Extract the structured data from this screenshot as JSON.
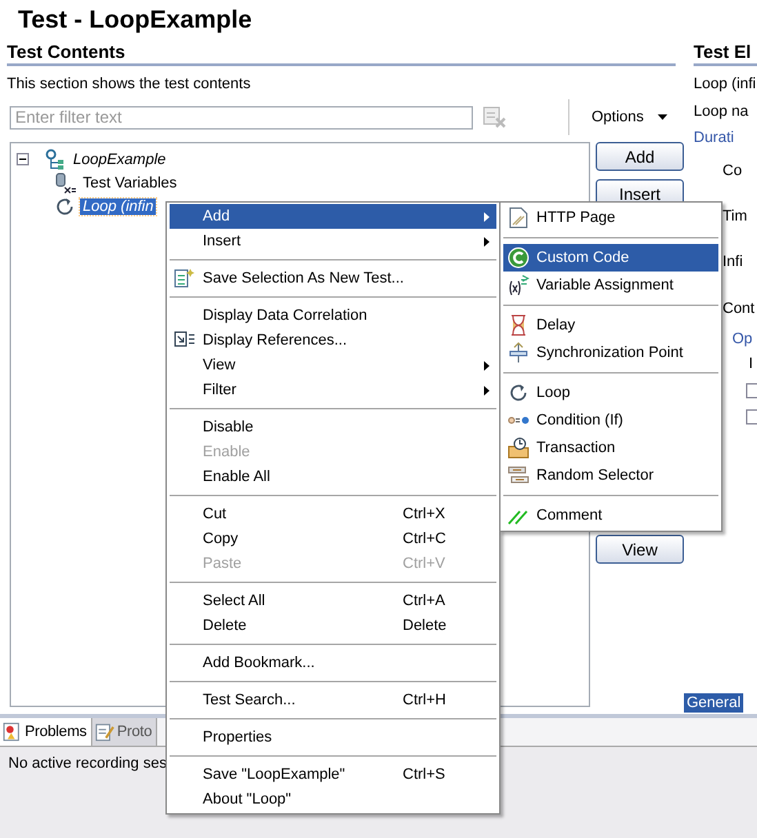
{
  "editor": {
    "title": "Test - LoopExample"
  },
  "contents": {
    "heading": "Test Contents",
    "description": "This section shows the test contents",
    "filter": {
      "placeholder": "Enter filter text"
    },
    "options": "Options",
    "tree": [
      {
        "label": "LoopExample",
        "kind": "test",
        "italic": true,
        "expanded": true,
        "selected": false,
        "children": [
          {
            "label": "Test Variables",
            "kind": "variables",
            "italic": false,
            "selected": false
          },
          {
            "label": "Loop (infin",
            "kind": "loop",
            "italic": true,
            "selected": true
          }
        ]
      }
    ],
    "buttons": [
      "Add",
      "Insert",
      "View"
    ]
  },
  "details": {
    "heading": "Test El",
    "summary": "Loop (infi",
    "name_label": "Loop na",
    "duration_group": "Durati",
    "radios": [
      "Co",
      "Tim",
      "Infi"
    ],
    "control_label": "Cont",
    "options_group": "Op",
    "option_label": "I",
    "checkboxes": [
      {
        "checked": false
      },
      {
        "checked": false
      }
    ],
    "tab": "General"
  },
  "bottom": {
    "tabs": [
      {
        "label": "Problems",
        "kind": "problems",
        "selected": true
      },
      {
        "label": "Proto",
        "kind": "protocol",
        "selected": false
      }
    ],
    "status": "No active recording ses"
  },
  "context_menu": {
    "groups": [
      [
        {
          "label": "Add",
          "submenu": true,
          "disabled": false,
          "selected": true
        },
        {
          "label": "Insert",
          "submenu": true,
          "disabled": false,
          "selected": false
        }
      ],
      [
        {
          "label": "Save Selection As New Test...",
          "kind": "save-selection",
          "submenu": false,
          "disabled": false,
          "selected": false
        }
      ],
      [
        {
          "label": "Display Data Correlation",
          "submenu": false,
          "disabled": false,
          "selected": false
        },
        {
          "label": "Display References...",
          "kind": "references",
          "submenu": false,
          "disabled": false,
          "selected": false
        },
        {
          "label": "View",
          "submenu": true,
          "disabled": false,
          "selected": false
        },
        {
          "label": "Filter",
          "submenu": true,
          "disabled": false,
          "selected": false
        }
      ],
      [
        {
          "label": "Disable",
          "submenu": false,
          "disabled": false,
          "selected": false
        },
        {
          "label": "Enable",
          "submenu": false,
          "disabled": true,
          "selected": false
        },
        {
          "label": "Enable All",
          "submenu": false,
          "disabled": false,
          "selected": false
        }
      ],
      [
        {
          "label": "Cut",
          "shortcut": "Ctrl+X",
          "submenu": false,
          "disabled": false,
          "selected": false
        },
        {
          "label": "Copy",
          "shortcut": "Ctrl+C",
          "submenu": false,
          "disabled": false,
          "selected": false
        },
        {
          "label": "Paste",
          "shortcut": "Ctrl+V",
          "submenu": false,
          "disabled": true,
          "selected": false
        }
      ],
      [
        {
          "label": "Select All",
          "shortcut": "Ctrl+A",
          "submenu": false,
          "disabled": false,
          "selected": false
        },
        {
          "label": "Delete",
          "shortcut": "Delete",
          "submenu": false,
          "disabled": false,
          "selected": false
        }
      ],
      [
        {
          "label": "Add Bookmark...",
          "submenu": false,
          "disabled": false,
          "selected": false
        }
      ],
      [
        {
          "label": "Test Search...",
          "shortcut": "Ctrl+H",
          "submenu": false,
          "disabled": false,
          "selected": false
        }
      ],
      [
        {
          "label": "Properties",
          "submenu": false,
          "disabled": false,
          "selected": false
        }
      ],
      [
        {
          "label": "Save \"LoopExample\"",
          "shortcut": "Ctrl+S",
          "submenu": false,
          "disabled": false,
          "selected": false
        },
        {
          "label": "About \"Loop\"",
          "submenu": false,
          "disabled": false,
          "selected": false
        }
      ]
    ]
  },
  "submenu": {
    "groups": [
      [
        {
          "label": "HTTP Page",
          "kind": "http",
          "selected": false
        }
      ],
      [
        {
          "label": "Custom Code",
          "kind": "custom-code",
          "selected": true
        },
        {
          "label": "Variable Assignment",
          "kind": "variable",
          "selected": false
        }
      ],
      [
        {
          "label": "Delay",
          "kind": "delay",
          "selected": false
        },
        {
          "label": "Synchronization Point",
          "kind": "sync",
          "selected": false
        }
      ],
      [
        {
          "label": "Loop",
          "kind": "loop",
          "selected": false
        },
        {
          "label": "Condition (If)",
          "kind": "condition",
          "selected": false
        },
        {
          "label": "Transaction",
          "kind": "transaction",
          "selected": false
        },
        {
          "label": "Random Selector",
          "kind": "random",
          "selected": false
        }
      ],
      [
        {
          "label": "Comment",
          "kind": "comment",
          "selected": false
        }
      ]
    ]
  }
}
